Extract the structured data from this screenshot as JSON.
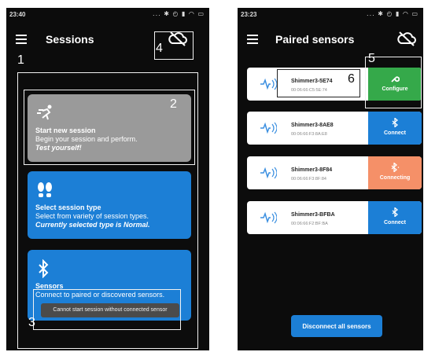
{
  "left": {
    "status_time": "23:40",
    "status_icons": "... ✱ ◴ ▮ ◠ ▭",
    "title": "Sessions",
    "cards": [
      {
        "title": "Start new session",
        "desc": "Begin your session and perform.",
        "italic": "Test yourself!"
      },
      {
        "title": "Select session type",
        "desc": "Select from variety of session types.",
        "italic": "Currently selected type is Normal."
      },
      {
        "title": "Sensors",
        "desc": "Connect to paired or discovered sensors.",
        "italic": ""
      }
    ],
    "toast": "Cannot start session without connected sensor"
  },
  "right": {
    "status_time": "23:23",
    "status_icons": "... ✱ ◴ ▮ ◠ ▭",
    "title": "Paired sensors",
    "sensors": [
      {
        "name": "Shimmer3-5E74",
        "mac": "00:06:66:C5:5E:74",
        "action": "Configure",
        "state": "configure"
      },
      {
        "name": "Shimmer3-8AE8",
        "mac": "00:06:66:F3:8A:E8",
        "action": "Connect",
        "state": "connect"
      },
      {
        "name": "Shimmer3-8F84",
        "mac": "00:06:66:F3:8F:84",
        "action": "Connecting",
        "state": "connecting"
      },
      {
        "name": "Shimmer3-BFBA",
        "mac": "00:06:66:F2:BF:BA",
        "action": "Connect",
        "state": "connect"
      }
    ],
    "disconnect_label": "Disconnect all sensors"
  },
  "annotations": [
    "1",
    "2",
    "3",
    "4",
    "5",
    "6"
  ],
  "colors": {
    "blue": "#1c7fd6",
    "green": "#35a94a",
    "orange": "#f59068",
    "gray": "#9a9a9a"
  }
}
